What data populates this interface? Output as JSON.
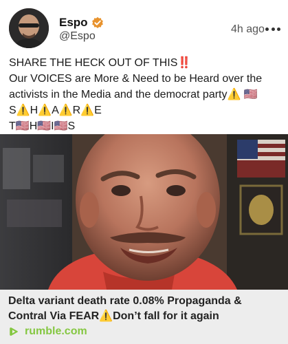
{
  "post": {
    "author": {
      "display_name": "Espo",
      "handle": "@Espo",
      "verified_icon": "verified-badge-icon",
      "avatar_icon": "avatar"
    },
    "timestamp": "4h ago",
    "more_icon": "more-options-icon",
    "body_lines": [
      "SHARE THE HECK OUT OF THIS‼️",
      "Our VOICES are More & Need to be Heard over the",
      "activists in the Media and the democrat party⚠️ 🇺🇸",
      "S⚠️H⚠️A⚠️R⚠️E",
      "T🇺🇸H🇺🇸I🇺🇸S"
    ]
  },
  "link_card": {
    "title": "Delta variant death rate 0.08% Propaganda & Contral Via FEAR⚠️Don’t fall for it again",
    "source": "rumble.com",
    "source_icon": "rumble-play-icon"
  },
  "colors": {
    "verified_badge": "#e8932e",
    "rumble_green": "#85c742",
    "card_background": "#ededed",
    "shirt_red": "#d8453a"
  }
}
